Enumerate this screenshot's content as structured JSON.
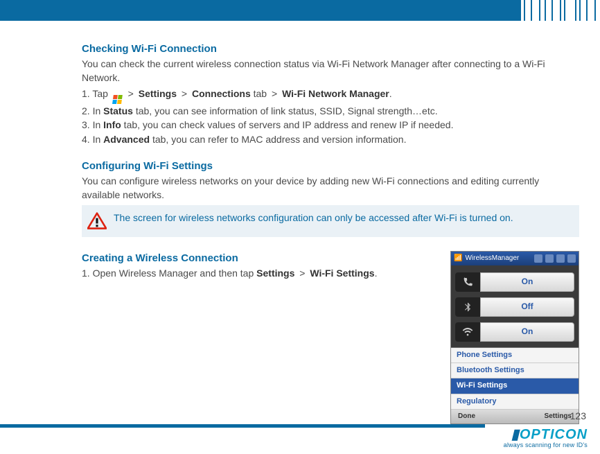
{
  "section1": {
    "title": "Checking Wi-Fi Connection",
    "intro": "You can check the current wireless connection status via Wi-Fi Network Manager after connecting to a Wi-Fi Network.",
    "step1_pre": "1. Tap ",
    "step1_s": "Settings",
    "step1_c": "Connections",
    "step1_tab": " tab ",
    "step1_w": "Wi-Fi Network Manager",
    "step2_pre": "2. In ",
    "step2_b": "Status",
    "step2_post": " tab, you can see information of link status, SSID, Signal strength…etc.",
    "step3_pre": "3. In ",
    "step3_b": "Info",
    "step3_post": " tab, you can check values of servers and IP address and renew IP if needed.",
    "step4_pre": "4. In ",
    "step4_b": "Advanced",
    "step4_post": " tab, you can refer to MAC address and version information."
  },
  "section2": {
    "title": "Configuring Wi-Fi Settings",
    "intro": "You can configure wireless networks on your device by adding new Wi-Fi connections and editing currently available networks."
  },
  "alert": {
    "text": "The screen for wireless networks configuration can only be accessed after Wi-Fi is turned on."
  },
  "section3": {
    "title": "Creating a Wireless Connection",
    "step1_pre": "1. Open Wireless Manager and then tap ",
    "step1_s": "Settings",
    "step1_w": "Wi-Fi Settings",
    "step1_post": "."
  },
  "device": {
    "title": "WirelessManager",
    "row1": "On",
    "row2": "Off",
    "row3": "On",
    "menu": [
      "Phone Settings",
      "Bluetooth Settings",
      "Wi-Fi Settings",
      "Regulatory"
    ],
    "foot_left": "Done",
    "foot_right": "Settings"
  },
  "page_number": "123",
  "brand": {
    "name": "OPTICON",
    "tagline": "always scanning for new ID's"
  },
  "gt": ">"
}
